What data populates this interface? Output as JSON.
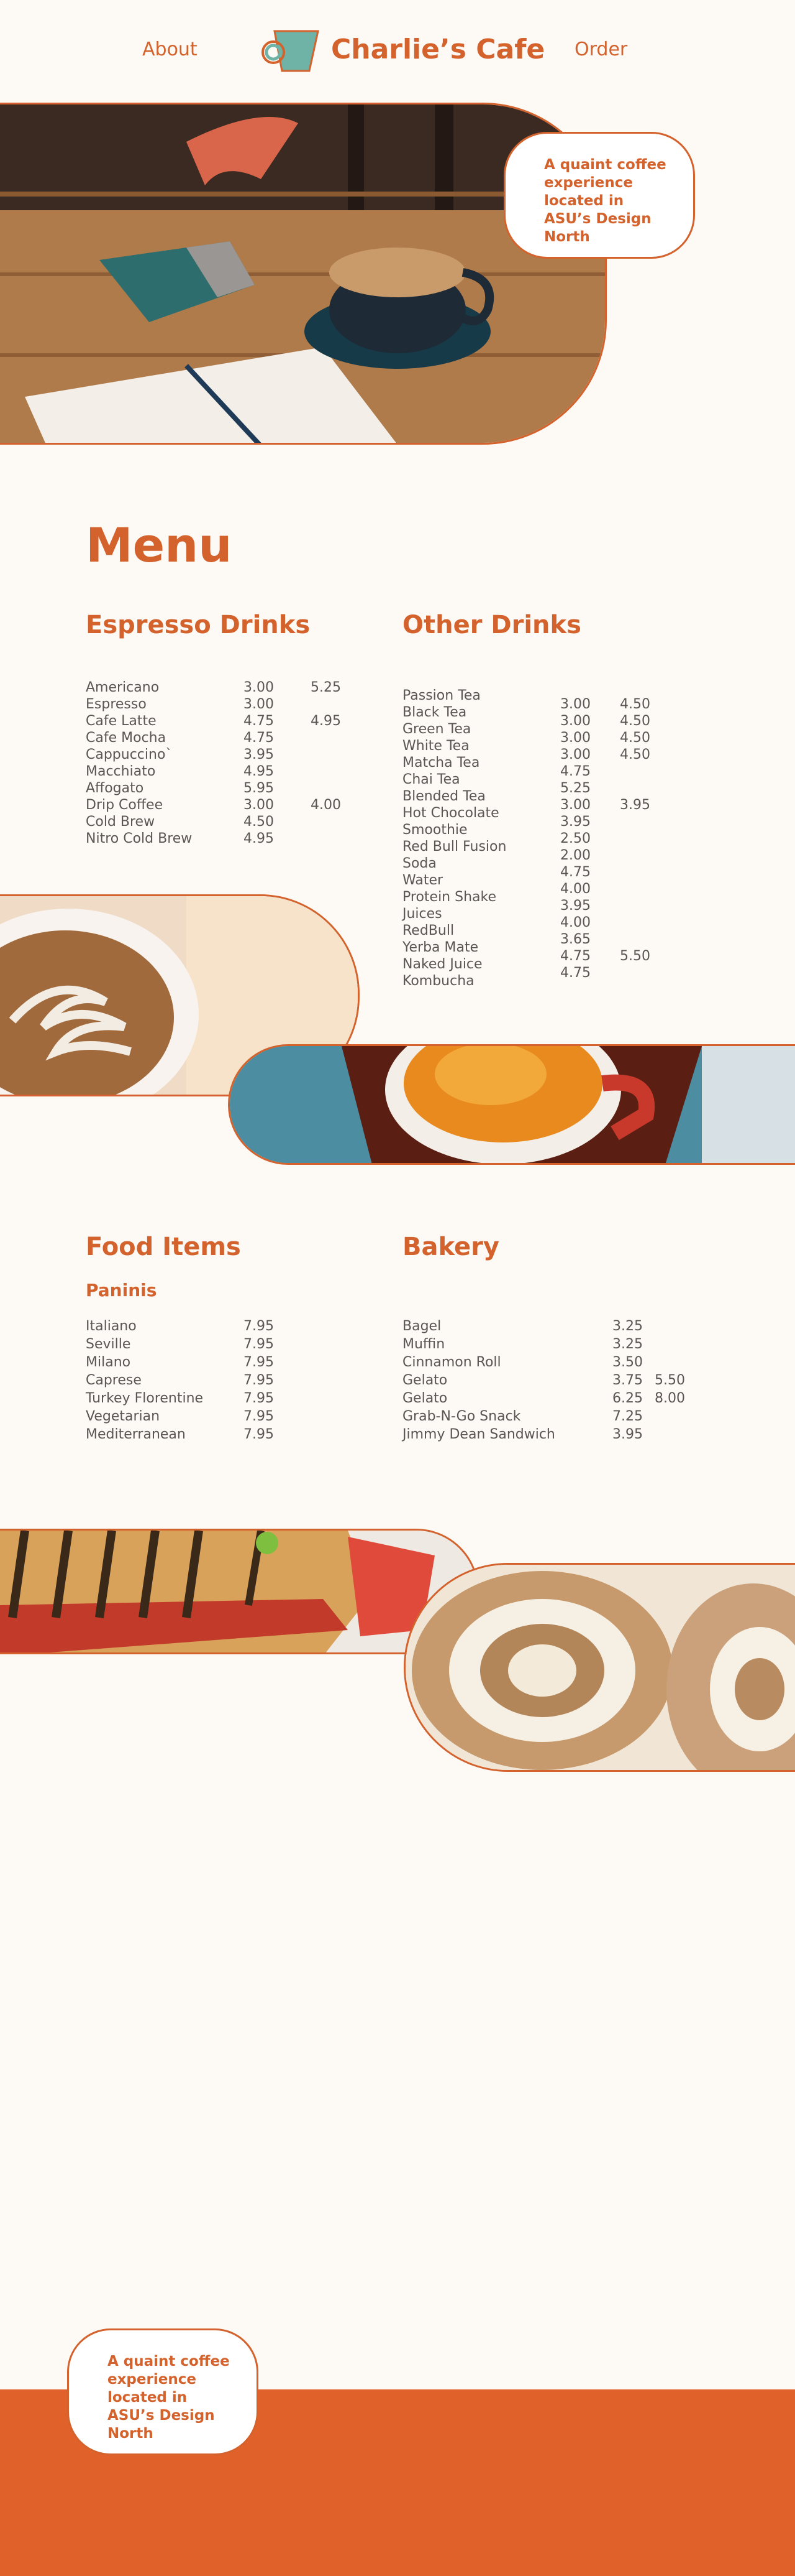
{
  "header": {
    "nav_about": "About",
    "brand_name": "Charlie’s Cafe",
    "nav_order": "Order",
    "logo_icon": "coffee-cup-icon"
  },
  "hero": {
    "tagline": "A quaint coffee experience located in ASU’s Design North"
  },
  "menu": {
    "title": "Menu",
    "espresso": {
      "heading": "Espresso Drinks",
      "items": [
        {
          "name": "Americano",
          "p1": "3.00",
          "p2": "5.25"
        },
        {
          "name": "Espresso",
          "p1": "3.00",
          "p2": ""
        },
        {
          "name": "Cafe Latte",
          "p1": "4.75",
          "p2": "4.95"
        },
        {
          "name": "Cafe Mocha",
          "p1": "4.75",
          "p2": ""
        },
        {
          "name": "Cappuccino`",
          "p1": "3.95",
          "p2": ""
        },
        {
          "name": "Macchiato",
          "p1": "4.95",
          "p2": ""
        },
        {
          "name": "Affogato",
          "p1": "5.95",
          "p2": ""
        },
        {
          "name": "Drip Coffee",
          "p1": "3.00",
          "p2": "4.00"
        },
        {
          "name": "Cold Brew",
          "p1": "4.50",
          "p2": ""
        },
        {
          "name": "Nitro Cold Brew",
          "p1": "4.95",
          "p2": ""
        }
      ]
    },
    "other": {
      "heading": "Other Drinks",
      "names": [
        "Passion Tea",
        "Black Tea",
        "Green Tea",
        "White Tea",
        "Matcha Tea",
        "Chai Tea",
        "Blended Tea",
        "Hot Chocolate",
        "Smoothie",
        "Red Bull Fusion",
        "Soda",
        "Water",
        "Protein Shake",
        "Juices",
        "RedBull",
        "Yerba Mate",
        "Naked Juice",
        "Kombucha"
      ],
      "prices": [
        {
          "p1": "3.00",
          "p2": "4.50"
        },
        {
          "p1": "3.00",
          "p2": "4.50"
        },
        {
          "p1": "3.00",
          "p2": "4.50"
        },
        {
          "p1": "3.00",
          "p2": "4.50"
        },
        {
          "p1": "4.75",
          "p2": ""
        },
        {
          "p1": "5.25",
          "p2": ""
        },
        {
          "p1": "3.00",
          "p2": "3.95"
        },
        {
          "p1": "3.95",
          "p2": ""
        },
        {
          "p1": "2.50",
          "p2": ""
        },
        {
          "p1": "2.00",
          "p2": ""
        },
        {
          "p1": "4.75",
          "p2": ""
        },
        {
          "p1": "4.00",
          "p2": ""
        },
        {
          "p1": "3.95",
          "p2": ""
        },
        {
          "p1": "4.00",
          "p2": ""
        },
        {
          "p1": "3.65",
          "p2": ""
        },
        {
          "p1": "4.75",
          "p2": "5.50"
        },
        {
          "p1": "4.75",
          "p2": ""
        }
      ]
    },
    "food": {
      "heading": "Food Items",
      "subheading": "Paninis",
      "items": [
        {
          "name": "Italiano",
          "p1": "7.95"
        },
        {
          "name": "Seville",
          "p1": "7.95"
        },
        {
          "name": "Milano",
          "p1": "7.95"
        },
        {
          "name": "Caprese",
          "p1": "7.95"
        },
        {
          "name": "Turkey Florentine",
          "p1": "7.95"
        },
        {
          "name": "Vegetarian",
          "p1": "7.95"
        },
        {
          "name": "Mediterranean",
          "p1": "7.95"
        }
      ]
    },
    "bakery": {
      "heading": "Bakery",
      "items": [
        {
          "name": "Bagel",
          "p1": "3.25",
          "p2": ""
        },
        {
          "name": "Muffin",
          "p1": "3.25",
          "p2": ""
        },
        {
          "name": "Cinnamon Roll",
          "p1": "3.50",
          "p2": ""
        },
        {
          "name": "Gelato",
          "p1": "3.75",
          "p2": "5.50"
        },
        {
          "name": "Gelato",
          "p1": "6.25",
          "p2": "8.00"
        },
        {
          "name": "Grab-N-Go Snack",
          "p1": "7.25",
          "p2": ""
        },
        {
          "name": "Jimmy Dean Sandwich",
          "p1": "3.95",
          "p2": ""
        }
      ]
    }
  },
  "footer": {
    "tagline": "A quaint coffee experience located in ASU’s Design North"
  },
  "colors": {
    "accent": "#d4622c",
    "footer": "#e0622a",
    "background": "#fdfaf6",
    "text": "#5b5654"
  }
}
